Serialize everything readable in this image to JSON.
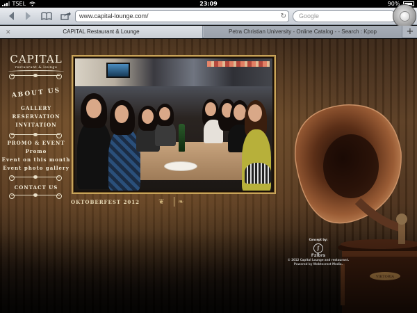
{
  "status_bar": {
    "carrier": "TSEL",
    "time": "23:09",
    "battery": "90%",
    "battery_level": 0.9
  },
  "browser": {
    "url": "www.capital-lounge.com/",
    "search_placeholder": "Google",
    "tabs": [
      {
        "title": "CAPITAL Restaurant & Lounge",
        "active": true
      },
      {
        "title": "Petra Christian University - Online Catalog - - Search : Kpop",
        "active": false
      }
    ],
    "new_tab": "+"
  },
  "site": {
    "logo": {
      "name": "CAPITAL",
      "tagline": "restaurant & lounge"
    },
    "menu": {
      "about": "ABOUT US",
      "gallery": "GALLERY",
      "reservation": "RESERVATION",
      "invitation": "INVITATION",
      "promo_event": "PROMO & EVENT",
      "promo": "Promo",
      "event_month": "Event on this month",
      "event_gallery": "Event photo gallery",
      "contact": "CONTACT US"
    },
    "caption": "OKTOBERFEST 2012",
    "credits": {
      "concept": "Concept by:",
      "brand": "Fzlbrs",
      "line1": "© 2012 Capital Lounge and restaurant.",
      "line2": "Powered by Webtecrest Media."
    },
    "gramophone_label": "VIKTORIA"
  },
  "colors": {
    "accent_gold": "#c8a45a",
    "menu_text": "#f3ecd9"
  }
}
